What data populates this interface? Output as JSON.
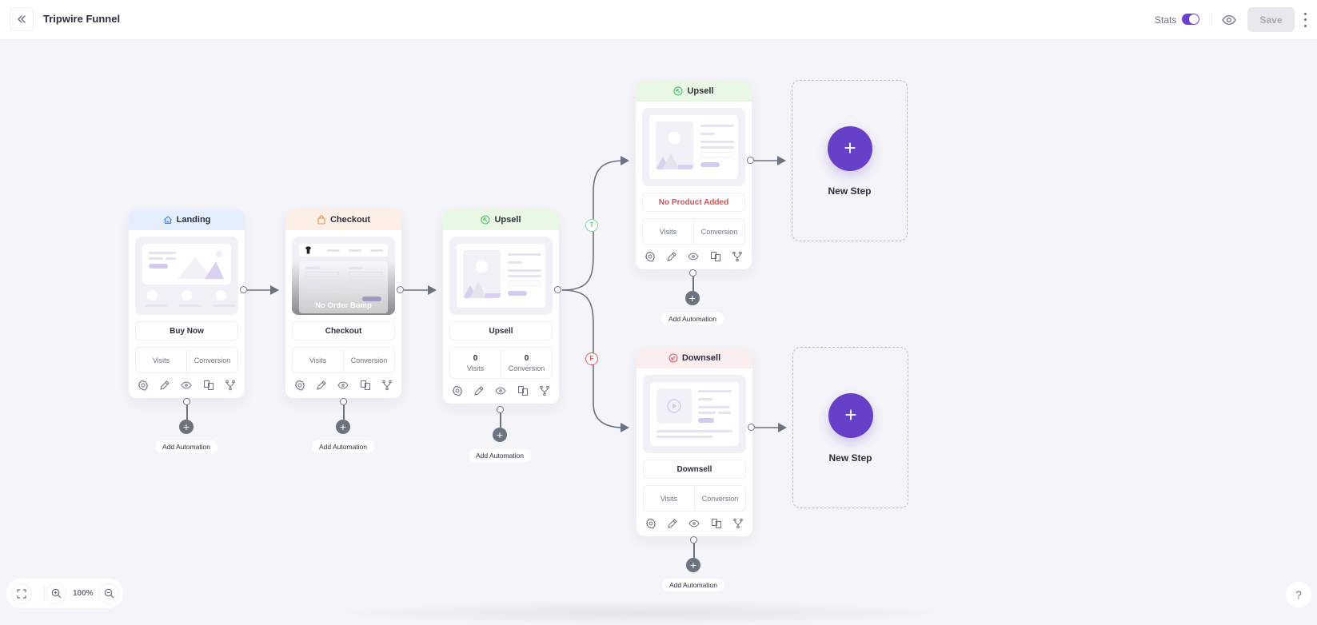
{
  "header": {
    "title": "Tripwire Funnel",
    "stats_label": "Stats",
    "stats_enabled": true,
    "save_label": "Save",
    "accent_color": "#6a3fd0"
  },
  "steps": [
    {
      "type": "Landing",
      "icon": "home-icon",
      "name": "Buy Now",
      "head_color": "#e5eefc",
      "visits": "",
      "conversion": "",
      "visits_label": "Visits",
      "conversion_label": "Conversion"
    },
    {
      "type": "Checkout",
      "icon": "shopping-bag-icon",
      "name": "Checkout",
      "overlay": "No Order Bump",
      "head_color": "#fcefe5",
      "visits": "",
      "conversion": "",
      "visits_label": "Visits",
      "conversion_label": "Conversion"
    },
    {
      "type": "Upsell",
      "icon": "upsell-arrow-icon",
      "name": "Upsell",
      "head_color": "#e9f7e5",
      "visits": "0",
      "conversion": "0",
      "visits_label": "Visits",
      "conversion_label": "Conversion"
    },
    {
      "type": "Upsell",
      "icon": "upsell-arrow-icon",
      "name": "No Product Added",
      "name_error": true,
      "head_color": "#e9f7e5",
      "visits": "",
      "conversion": "",
      "visits_label": "Visits",
      "conversion_label": "Conversion"
    },
    {
      "type": "Downsell",
      "icon": "downsell-arrow-icon",
      "name": "Downsell",
      "head_color": "#fbeeee",
      "visits": "",
      "conversion": "",
      "visits_label": "Visits",
      "conversion_label": "Conversion"
    }
  ],
  "branch": {
    "true_label": "T",
    "false_label": "F"
  },
  "automation": {
    "label": "Add Automation"
  },
  "new_step": {
    "label": "New Step"
  },
  "zoom": {
    "level": "100%"
  },
  "help": {
    "label": "?"
  }
}
